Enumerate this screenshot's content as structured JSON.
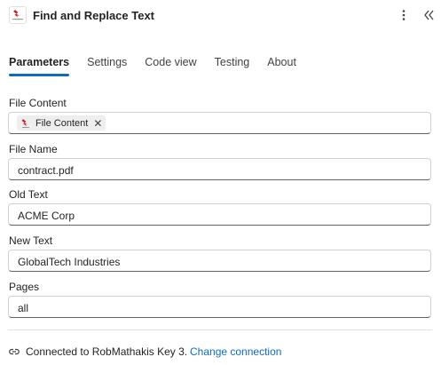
{
  "header": {
    "title": "Find and Replace Text",
    "logo_icon": "robot-logo-icon",
    "more_icon": "more-vertical-icon",
    "collapse_icon": "double-chevron-left-icon"
  },
  "tabs": [
    {
      "label": "Parameters",
      "active": true
    },
    {
      "label": "Settings"
    },
    {
      "label": "Code view"
    },
    {
      "label": "Testing"
    },
    {
      "label": "About"
    }
  ],
  "fields": {
    "file_content": {
      "label": "File Content",
      "chip_label": "File Content"
    },
    "file_name": {
      "label": "File Name",
      "value": "contract.pdf"
    },
    "old_text": {
      "label": "Old Text",
      "value": "ACME Corp"
    },
    "new_text": {
      "label": "New Text",
      "value": "GlobalTech Industries"
    },
    "pages": {
      "label": "Pages",
      "value": "all"
    }
  },
  "footer": {
    "connection_text": "Connected to RobMathakis Key 3.",
    "change_link": "Change connection"
  },
  "colors": {
    "accent": "#0f6cbd",
    "logo_red": "#c4262e"
  }
}
